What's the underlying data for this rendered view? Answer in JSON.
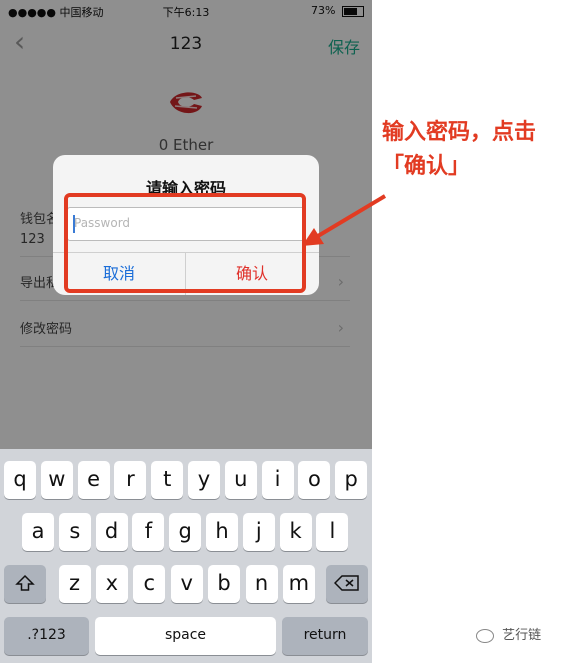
{
  "status_bar": {
    "carrier": "●●●●● 中国移动 ",
    "time": "下午6:13",
    "battery": "73%"
  },
  "nav": {
    "back_icon": "chevron-left-icon",
    "title": "123",
    "save_label": "保存"
  },
  "wallet": {
    "balance": "0 Ether"
  },
  "rows": {
    "name_label": "钱包名",
    "name_value": "123",
    "export_label": "导出私",
    "change_password_label": "修改密码"
  },
  "dialog": {
    "title": "请输入密码",
    "password_placeholder": "Password",
    "cancel_label": "取消",
    "confirm_label": "确认"
  },
  "annotation": {
    "text": "输入密码，点击「确认」",
    "color": "#e23b22"
  },
  "keyboard": {
    "row1": [
      "q",
      "w",
      "e",
      "r",
      "t",
      "y",
      "u",
      "i",
      "o",
      "p"
    ],
    "row2": [
      "a",
      "s",
      "d",
      "f",
      "g",
      "h",
      "j",
      "k",
      "l"
    ],
    "row3": [
      "z",
      "x",
      "c",
      "v",
      "b",
      "n",
      "m"
    ],
    "numbers_label": ".?123",
    "space_label": "space",
    "return_label": "return"
  },
  "watermark": {
    "text": "艺行链"
  },
  "colors": {
    "accent": "#1aa98a",
    "cancel": "#1a6dd8",
    "confirm": "#e0302a"
  }
}
